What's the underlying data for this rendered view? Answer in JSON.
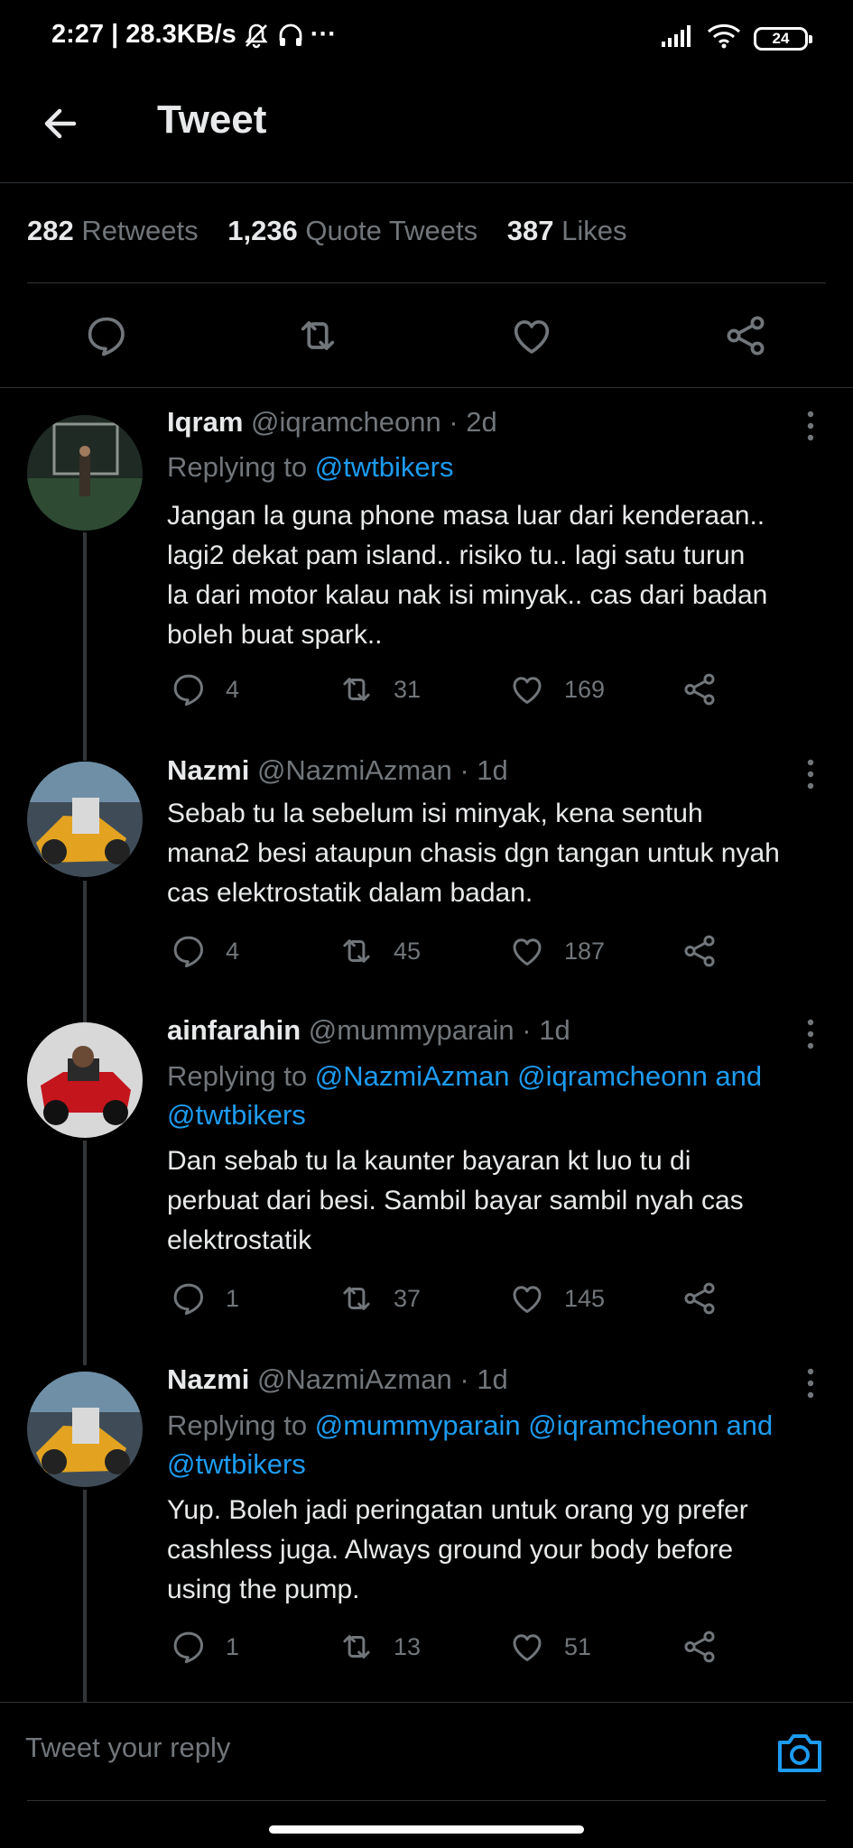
{
  "status_bar": {
    "time_speed": "2:27 | 28.3KB/s",
    "extra_icons": "···",
    "battery": "24",
    "icons": [
      "mute-bell-icon",
      "headphones-icon",
      "signal-icon",
      "wifi-icon",
      "battery-icon"
    ]
  },
  "header": {
    "title": "Tweet",
    "back_icon": "arrow-left-icon"
  },
  "stats": {
    "retweets_count": "282",
    "retweets_label": "Retweets",
    "quotes_count": "1,236",
    "quotes_label": "Quote Tweets",
    "likes_count": "387",
    "likes_label": "Likes"
  },
  "main_actions": [
    "reply-icon",
    "retweet-icon",
    "like-icon",
    "share-icon"
  ],
  "replies": [
    {
      "name": "Iqram",
      "handle": "@iqramcheonn",
      "time": "· 2d",
      "replying_prefix": "Replying to ",
      "replying_to": "@twtbikers",
      "lines": [
        "Jangan la guna phone masa luar dari kenderaan..",
        "lagi2 dekat pam island.. risiko tu.. lagi satu turun",
        "la dari motor kalau nak isi minyak.. cas dari badan",
        "boleh buat spark.."
      ],
      "replies": "4",
      "retweets": "31",
      "likes": "169"
    },
    {
      "name": "Nazmi",
      "handle": "@NazmiAzman",
      "time": "· 1d",
      "lines": [
        "Sebab tu la sebelum isi minyak, kena sentuh",
        "mana2 besi ataupun chasis dgn tangan untuk nyah",
        "cas elektrostatik dalam badan."
      ],
      "replies": "4",
      "retweets": "45",
      "likes": "187"
    },
    {
      "name": "ainfarahin",
      "handle": "@mummyparain",
      "time": "· 1d",
      "replying_prefix": "Replying to ",
      "replying_line1": "@NazmiAzman @iqramcheonn and",
      "replying_line2": "@twtbikers",
      "lines": [
        "Dan sebab tu la kaunter bayaran kt luo tu di",
        "perbuat dari besi. Sambil bayar sambil nyah cas",
        "elektrostatik"
      ],
      "replies": "1",
      "retweets": "37",
      "likes": "145"
    },
    {
      "name": "Nazmi",
      "handle": "@NazmiAzman",
      "time": "· 1d",
      "replying_prefix": "Replying to ",
      "replying_line1": "@mummyparain @iqramcheonn and",
      "replying_line2": "@twtbikers",
      "lines": [
        "Yup. Boleh jadi peringatan untuk orang yg prefer",
        "cashless juga. Always ground your body before",
        "using the pump."
      ],
      "replies": "1",
      "retweets": "13",
      "likes": "51"
    }
  ],
  "composer": {
    "placeholder": "Tweet your reply",
    "camera_icon": "camera-icon"
  },
  "colors": {
    "background": "#000000",
    "accent": "#1d9bf0",
    "muted": "#71767b",
    "text": "#e7e9ea",
    "divider": "#2f3336"
  }
}
